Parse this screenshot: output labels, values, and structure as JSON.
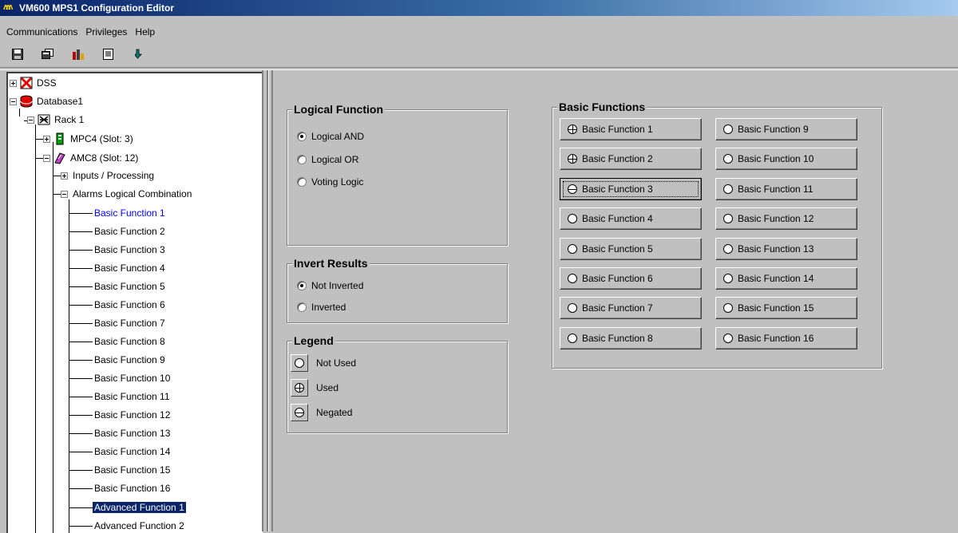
{
  "window": {
    "title": "VM600 MPS1 Configuration Editor",
    "app_icon": "vibro-meter-logo"
  },
  "menu": [
    "Communications",
    "Privileges",
    "Help"
  ],
  "toolbar": [
    {
      "icon": "save-icon"
    },
    {
      "icon": "copy-icon"
    },
    {
      "icon": "chart-icon"
    },
    {
      "icon": "document-icon"
    },
    {
      "icon": "download-arrow-icon"
    }
  ],
  "tree": {
    "dss": "DSS",
    "database": "Database1",
    "rack": "Rack 1",
    "mpc4": "MPC4 (Slot:  3)",
    "amc8": "AMC8 (Slot: 12)",
    "inputs": "Inputs / Processing",
    "alarms": "Alarms Logical Combination",
    "functions": [
      "Basic Function 1",
      "Basic Function 2",
      "Basic Function 3",
      "Basic Function 4",
      "Basic Function 5",
      "Basic Function 6",
      "Basic Function 7",
      "Basic Function 8",
      "Basic Function 9",
      "Basic Function 10",
      "Basic Function 11",
      "Basic Function 12",
      "Basic Function 13",
      "Basic Function 14",
      "Basic Function 15",
      "Basic Function 16",
      "Advanced Function 1",
      "Advanced Function 2"
    ]
  },
  "logical_function": {
    "title": "Logical Function",
    "options": [
      "Logical AND",
      "Logical OR",
      "Voting Logic"
    ],
    "selected": "Logical AND"
  },
  "invert_results": {
    "title": "Invert Results",
    "options": [
      "Not Inverted",
      "Inverted"
    ],
    "selected": "Not Inverted"
  },
  "legend": {
    "title": "Legend",
    "items": [
      {
        "symbol": "circle",
        "label": "Not Used"
      },
      {
        "symbol": "circle-plus",
        "label": "Used"
      },
      {
        "symbol": "circle-minus",
        "label": "Negated"
      }
    ]
  },
  "basic_functions": {
    "title": "Basic Functions",
    "buttons": [
      {
        "label": "Basic Function 1",
        "state": "used"
      },
      {
        "label": "Basic Function 2",
        "state": "used"
      },
      {
        "label": "Basic Function 3",
        "state": "negated"
      },
      {
        "label": "Basic Function 4",
        "state": "not-used"
      },
      {
        "label": "Basic Function 5",
        "state": "not-used"
      },
      {
        "label": "Basic Function 6",
        "state": "not-used"
      },
      {
        "label": "Basic Function 7",
        "state": "not-used"
      },
      {
        "label": "Basic Function 8",
        "state": "not-used"
      },
      {
        "label": "Basic Function 9",
        "state": "not-used"
      },
      {
        "label": "Basic Function 10",
        "state": "not-used"
      },
      {
        "label": "Basic Function 11",
        "state": "not-used"
      },
      {
        "label": "Basic Function 12",
        "state": "not-used"
      },
      {
        "label": "Basic Function 13",
        "state": "not-used"
      },
      {
        "label": "Basic Function 14",
        "state": "not-used"
      },
      {
        "label": "Basic Function 15",
        "state": "not-used"
      },
      {
        "label": "Basic Function 16",
        "state": "not-used"
      }
    ]
  }
}
